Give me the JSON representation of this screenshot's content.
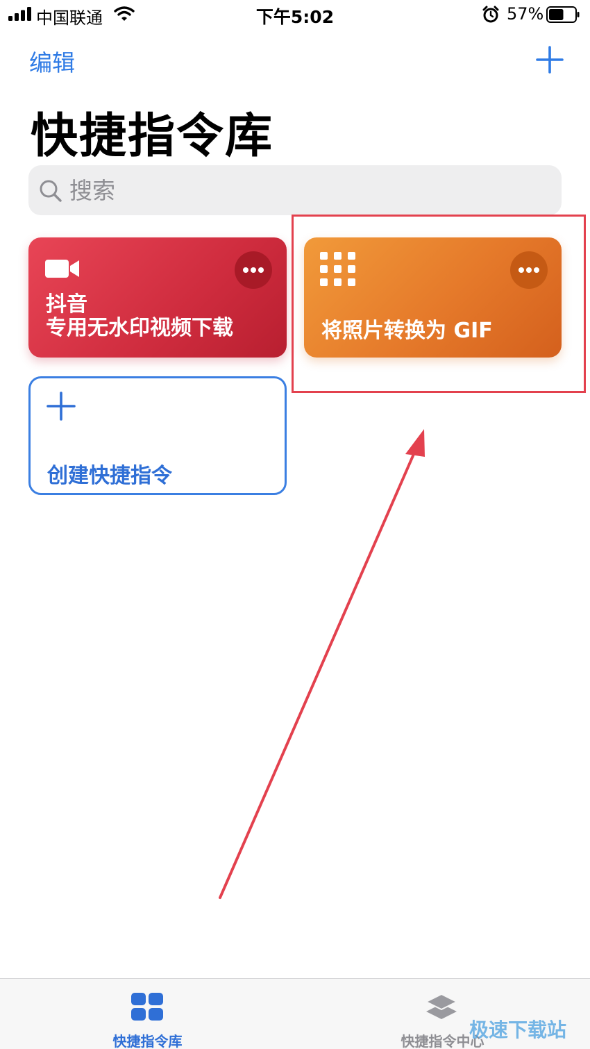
{
  "status_bar": {
    "carrier": "中国联通",
    "time": "下午5:02",
    "battery_percent": "57%",
    "battery_level": 0.57
  },
  "nav": {
    "edit_label": "编辑",
    "add_icon": "plus-icon"
  },
  "page": {
    "title": "快捷指令库"
  },
  "search": {
    "placeholder": "搜索"
  },
  "shortcuts": [
    {
      "title_line1": "抖音",
      "title_line2": "专用无水印视频下载",
      "icon": "video-camera-icon",
      "color": "#d8303f"
    },
    {
      "title": "将照片转换为 GIF",
      "icon": "grid-icon",
      "color": "#e5792a"
    }
  ],
  "create": {
    "label": "创建快捷指令"
  },
  "tabs": [
    {
      "label": "快捷指令库",
      "icon": "library-grid-icon",
      "active": true
    },
    {
      "label": "快捷指令中心",
      "icon": "layers-icon",
      "active": false
    }
  ],
  "colors": {
    "accent": "#2f7be5",
    "annotation": "#e3414e"
  },
  "watermark": "极速下载站"
}
